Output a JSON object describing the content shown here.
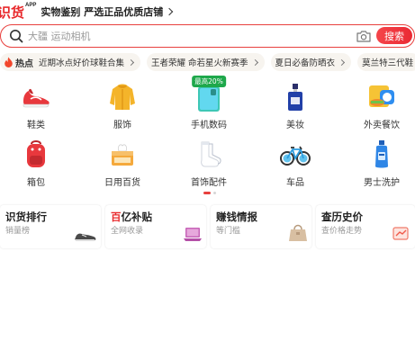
{
  "header": {
    "logo": "识货",
    "logo_sup": "APP",
    "slogan": "实物鉴别 严选正品优质店铺"
  },
  "search": {
    "placeholder": "大疆 运动相机",
    "button_label": "搜索"
  },
  "hot": {
    "label": "热点",
    "topics": [
      "近期冰点好价球鞋合集",
      "王者荣耀 命若星火新赛季",
      "夏日必备防晒衣",
      "莫兰特三代鞋"
    ]
  },
  "categories": [
    {
      "label": "鞋类",
      "icon": "sneaker-icon"
    },
    {
      "label": "服饰",
      "icon": "jacket-icon"
    },
    {
      "label": "手机数码",
      "icon": "phone-icon",
      "badge": "最高20%"
    },
    {
      "label": "美妆",
      "icon": "perfume-icon"
    },
    {
      "label": "外卖餐饮",
      "icon": "food-delivery-icon"
    },
    {
      "label": "箱包",
      "icon": "backpack-icon"
    },
    {
      "label": "日用百货",
      "icon": "tissue-box-icon"
    },
    {
      "label": "首饰配件",
      "icon": "socks-icon"
    },
    {
      "label": "车品",
      "icon": "bicycle-icon"
    },
    {
      "label": "男士洗护",
      "icon": "shampoo-bottle-icon"
    }
  ],
  "carousel": {
    "pages": 2,
    "active_page": 1
  },
  "features": [
    {
      "title": "识货排行",
      "highlight": "",
      "subtitle": "销量榜"
    },
    {
      "title": "亿补贴",
      "highlight": "百",
      "subtitle": "全网收录"
    },
    {
      "title": "赚钱情报",
      "highlight": "",
      "subtitle": "等门槛"
    },
    {
      "title": "查历史价",
      "highlight": "",
      "subtitle": "查价格走势"
    }
  ],
  "colors": {
    "brand_red": "#e8282b",
    "search_border": "#e8403e",
    "chip_bg": "#f7f4ef",
    "badge_green": "#1ea84b"
  }
}
